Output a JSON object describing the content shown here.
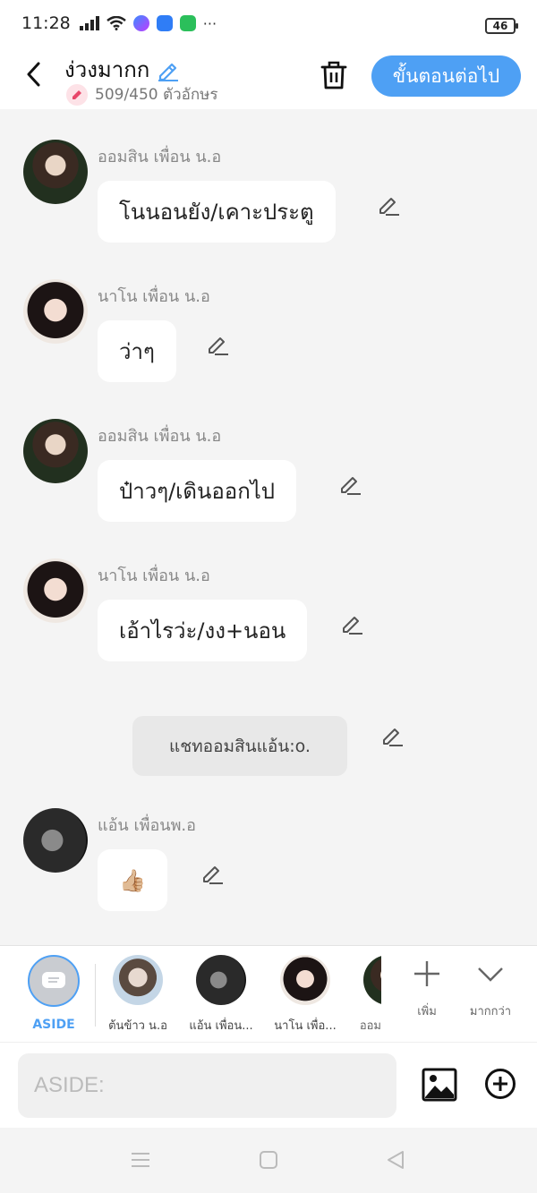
{
  "status": {
    "time": "11:28",
    "battery": "46",
    "more": "···"
  },
  "header": {
    "title": "ง่วงมากก",
    "counter": "509/450 ตัวอักษร",
    "next_label": "ขั้นตอนต่อไป"
  },
  "messages": [
    {
      "sender": "ออมสิน เพื่อน น.อ",
      "text": "โนนอนยัง/เคาะประตู"
    },
    {
      "sender": "นาโน เพื่อน น.อ",
      "text": "ว่าๆ"
    },
    {
      "sender": "ออมสิน เพื่อน น.อ",
      "text": "ป๋าวๆ/เดินออกไป"
    },
    {
      "sender": "นาโน เพื่อน น.อ",
      "text": "เอ้าไรว่ะ/งง+นอน"
    },
    {
      "sender": "แอ้น เพื่อนพ.อ",
      "text": "👍🏼"
    }
  ],
  "narration": "แชทออมสินแอ้น:o.",
  "characters": {
    "aside_label": "ASIDE",
    "items": [
      "ต้นข้าว น.อ",
      "แอ้น เพื่อน...",
      "นาโน เพื่อ...",
      "ออม"
    ],
    "add_label": "เพิ่ม",
    "more_label": "มากกว่า"
  },
  "input": {
    "placeholder": "ASIDE:"
  },
  "colors": {
    "accent": "#4ea0f4",
    "bubble": "#ffffff",
    "background": "#f4f4f4",
    "narration": "#e8e8e8"
  }
}
